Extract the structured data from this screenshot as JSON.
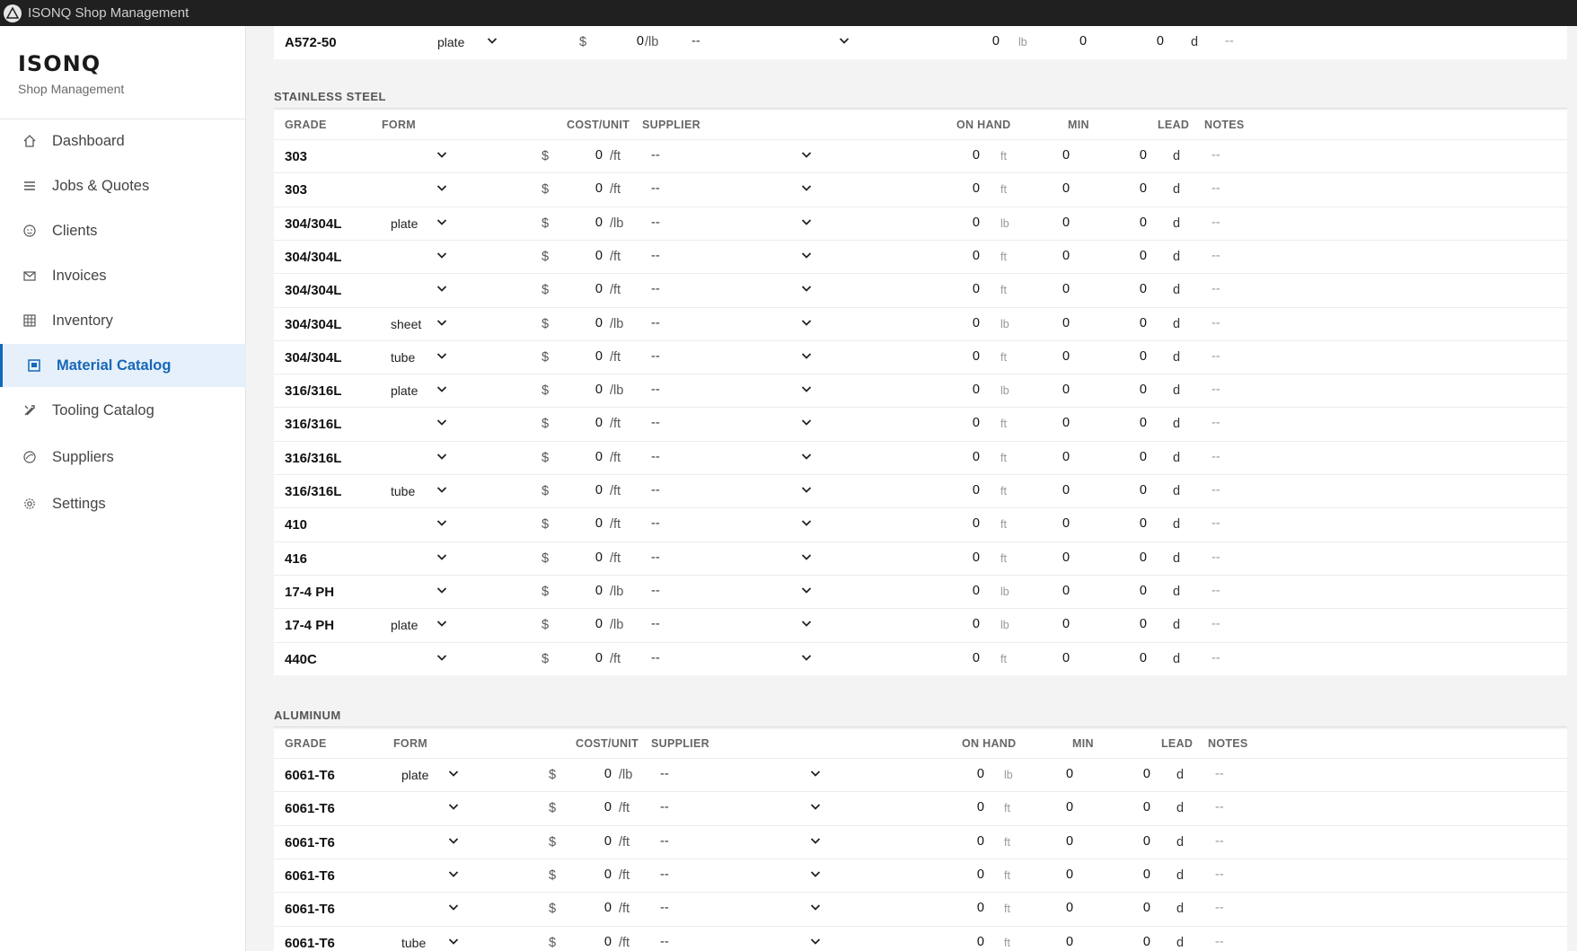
{
  "window": {
    "title": "ISONQ Shop Management"
  },
  "sidebar": {
    "brand": "ISONQ",
    "brand_sub": "Shop Management",
    "items": [
      {
        "label": "Dashboard",
        "icon": "home-icon"
      },
      {
        "label": "Jobs & Quotes",
        "icon": "list-icon"
      },
      {
        "label": "Clients",
        "icon": "smile-icon"
      },
      {
        "label": "Invoices",
        "icon": "mail-icon"
      },
      {
        "label": "Inventory",
        "icon": "grid-icon"
      },
      {
        "label": "Material Catalog",
        "icon": "catalog-icon",
        "active": true
      },
      {
        "label": "Tooling Catalog",
        "icon": "tools-icon"
      },
      {
        "label": "Suppliers",
        "icon": "globe-icon"
      },
      {
        "label": "Settings",
        "icon": "gear-icon"
      }
    ]
  },
  "top_row": {
    "grade": "A572-50",
    "form": "plate",
    "dollar": "$",
    "cost": "0",
    "unit": "/lb",
    "supplier": "--",
    "on_hand": "0",
    "on_hand_unit": "lb",
    "min": "0",
    "lead": "0",
    "lead_unit": "d",
    "notes": "--"
  },
  "headers": {
    "grade": "GRADE",
    "form": "FORM",
    "cost": "COST/UNIT",
    "supplier": "SUPPLIER",
    "on_hand": "ON HAND",
    "min": "MIN",
    "lead": "LEAD",
    "notes": "NOTES"
  },
  "sections": [
    {
      "title": "STAINLESS STEEL",
      "rows": [
        {
          "grade": "303",
          "form": "",
          "dollar": "$",
          "cost": "0",
          "unit": "/ft",
          "supplier": "--",
          "on_hand": "0",
          "on_hand_unit": "ft",
          "min": "0",
          "lead": "0",
          "lead_unit": "d",
          "notes": "--"
        },
        {
          "grade": "303",
          "form": "",
          "dollar": "$",
          "cost": "0",
          "unit": "/ft",
          "supplier": "--",
          "on_hand": "0",
          "on_hand_unit": "ft",
          "min": "0",
          "lead": "0",
          "lead_unit": "d",
          "notes": "--"
        },
        {
          "grade": "304/304L",
          "form": "plate",
          "dollar": "$",
          "cost": "0",
          "unit": "/lb",
          "supplier": "--",
          "on_hand": "0",
          "on_hand_unit": "lb",
          "min": "0",
          "lead": "0",
          "lead_unit": "d",
          "notes": "--"
        },
        {
          "grade": "304/304L",
          "form": "",
          "dollar": "$",
          "cost": "0",
          "unit": "/ft",
          "supplier": "--",
          "on_hand": "0",
          "on_hand_unit": "ft",
          "min": "0",
          "lead": "0",
          "lead_unit": "d",
          "notes": "--"
        },
        {
          "grade": "304/304L",
          "form": "",
          "dollar": "$",
          "cost": "0",
          "unit": "/ft",
          "supplier": "--",
          "on_hand": "0",
          "on_hand_unit": "ft",
          "min": "0",
          "lead": "0",
          "lead_unit": "d",
          "notes": "--"
        },
        {
          "grade": "304/304L",
          "form": "sheet",
          "dollar": "$",
          "cost": "0",
          "unit": "/lb",
          "supplier": "--",
          "on_hand": "0",
          "on_hand_unit": "lb",
          "min": "0",
          "lead": "0",
          "lead_unit": "d",
          "notes": "--"
        },
        {
          "grade": "304/304L",
          "form": "tube",
          "dollar": "$",
          "cost": "0",
          "unit": "/ft",
          "supplier": "--",
          "on_hand": "0",
          "on_hand_unit": "ft",
          "min": "0",
          "lead": "0",
          "lead_unit": "d",
          "notes": "--"
        },
        {
          "grade": "316/316L",
          "form": "plate",
          "dollar": "$",
          "cost": "0",
          "unit": "/lb",
          "supplier": "--",
          "on_hand": "0",
          "on_hand_unit": "lb",
          "min": "0",
          "lead": "0",
          "lead_unit": "d",
          "notes": "--"
        },
        {
          "grade": "316/316L",
          "form": "",
          "dollar": "$",
          "cost": "0",
          "unit": "/ft",
          "supplier": "--",
          "on_hand": "0",
          "on_hand_unit": "ft",
          "min": "0",
          "lead": "0",
          "lead_unit": "d",
          "notes": "--"
        },
        {
          "grade": "316/316L",
          "form": "",
          "dollar": "$",
          "cost": "0",
          "unit": "/ft",
          "supplier": "--",
          "on_hand": "0",
          "on_hand_unit": "ft",
          "min": "0",
          "lead": "0",
          "lead_unit": "d",
          "notes": "--"
        },
        {
          "grade": "316/316L",
          "form": "tube",
          "dollar": "$",
          "cost": "0",
          "unit": "/ft",
          "supplier": "--",
          "on_hand": "0",
          "on_hand_unit": "ft",
          "min": "0",
          "lead": "0",
          "lead_unit": "d",
          "notes": "--"
        },
        {
          "grade": "410",
          "form": "",
          "dollar": "$",
          "cost": "0",
          "unit": "/ft",
          "supplier": "--",
          "on_hand": "0",
          "on_hand_unit": "ft",
          "min": "0",
          "lead": "0",
          "lead_unit": "d",
          "notes": "--"
        },
        {
          "grade": "416",
          "form": "",
          "dollar": "$",
          "cost": "0",
          "unit": "/ft",
          "supplier": "--",
          "on_hand": "0",
          "on_hand_unit": "ft",
          "min": "0",
          "lead": "0",
          "lead_unit": "d",
          "notes": "--"
        },
        {
          "grade": "17-4 PH",
          "form": "",
          "dollar": "$",
          "cost": "0",
          "unit": "/lb",
          "supplier": "--",
          "on_hand": "0",
          "on_hand_unit": "lb",
          "min": "0",
          "lead": "0",
          "lead_unit": "d",
          "notes": "--"
        },
        {
          "grade": "17-4 PH",
          "form": "plate",
          "dollar": "$",
          "cost": "0",
          "unit": "/lb",
          "supplier": "--",
          "on_hand": "0",
          "on_hand_unit": "lb",
          "min": "0",
          "lead": "0",
          "lead_unit": "d",
          "notes": "--"
        },
        {
          "grade": "440C",
          "form": "",
          "dollar": "$",
          "cost": "0",
          "unit": "/ft",
          "supplier": "--",
          "on_hand": "0",
          "on_hand_unit": "ft",
          "min": "0",
          "lead": "0",
          "lead_unit": "d",
          "notes": "--"
        }
      ]
    },
    {
      "title": "ALUMINUM",
      "rows": [
        {
          "grade": "6061-T6",
          "form": "plate",
          "dollar": "$",
          "cost": "0",
          "unit": "/lb",
          "supplier": "--",
          "on_hand": "0",
          "on_hand_unit": "lb",
          "min": "0",
          "lead": "0",
          "lead_unit": "d",
          "notes": "--"
        },
        {
          "grade": "6061-T6",
          "form": "",
          "dollar": "$",
          "cost": "0",
          "unit": "/ft",
          "supplier": "--",
          "on_hand": "0",
          "on_hand_unit": "ft",
          "min": "0",
          "lead": "0",
          "lead_unit": "d",
          "notes": "--"
        },
        {
          "grade": "6061-T6",
          "form": "",
          "dollar": "$",
          "cost": "0",
          "unit": "/ft",
          "supplier": "--",
          "on_hand": "0",
          "on_hand_unit": "ft",
          "min": "0",
          "lead": "0",
          "lead_unit": "d",
          "notes": "--"
        },
        {
          "grade": "6061-T6",
          "form": "",
          "dollar": "$",
          "cost": "0",
          "unit": "/ft",
          "supplier": "--",
          "on_hand": "0",
          "on_hand_unit": "ft",
          "min": "0",
          "lead": "0",
          "lead_unit": "d",
          "notes": "--"
        },
        {
          "grade": "6061-T6",
          "form": "",
          "dollar": "$",
          "cost": "0",
          "unit": "/ft",
          "supplier": "--",
          "on_hand": "0",
          "on_hand_unit": "ft",
          "min": "0",
          "lead": "0",
          "lead_unit": "d",
          "notes": "--"
        },
        {
          "grade": "6061-T6",
          "form": "tube",
          "dollar": "$",
          "cost": "0",
          "unit": "/ft",
          "supplier": "--",
          "on_hand": "0",
          "on_hand_unit": "ft",
          "min": "0",
          "lead": "0",
          "lead_unit": "d",
          "notes": "--"
        }
      ]
    }
  ],
  "colors": {
    "accent": "#1668b8",
    "active_bg": "#e6f0fa",
    "titlebar": "#202020"
  }
}
